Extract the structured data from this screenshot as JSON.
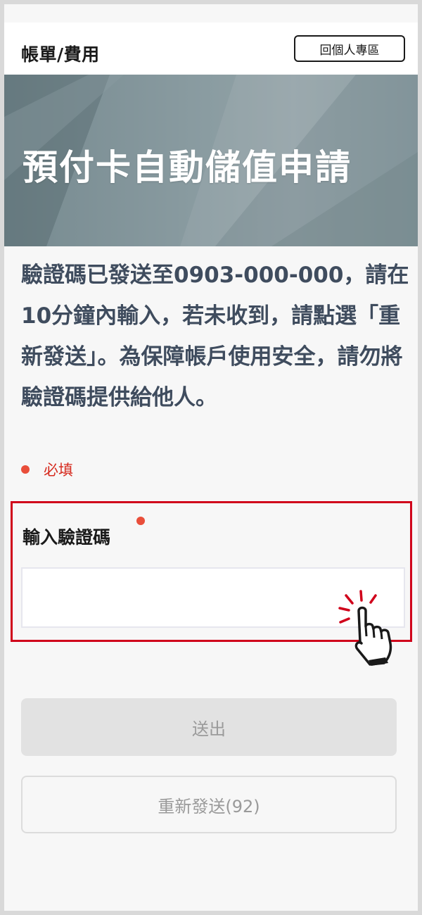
{
  "header": {
    "title": "帳單/費用",
    "back_label": "回個人專區"
  },
  "banner": {
    "title": "預付卡自動儲值申請"
  },
  "notice": {
    "text": "驗證碼已發送至0903-000-000，請在10分鐘內輸入，若未收到，請點選「重新發送」。為保障帳戶使用安全，請勿將驗證碼提供給他人。"
  },
  "form": {
    "required_label": "必填",
    "code_label": "輸入驗證碼",
    "code_value": ""
  },
  "buttons": {
    "submit_label": "送出",
    "resend_label": "重新發送(92)"
  },
  "colors": {
    "required_dot": "#e94e3a",
    "highlight_border": "#d0021b",
    "notice_text": "#3f4c5e"
  },
  "icons": {
    "hand": "tap-hand-icon"
  }
}
